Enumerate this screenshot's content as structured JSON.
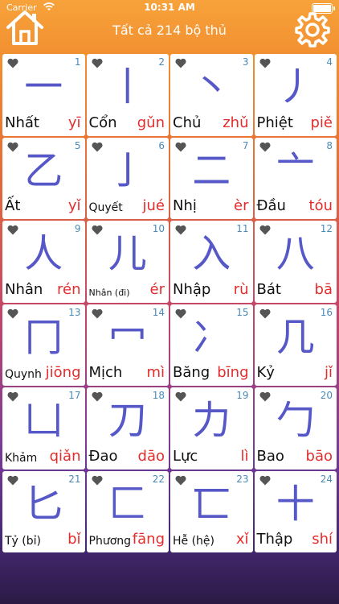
{
  "status_bar": {
    "carrier": "Carrier",
    "time": "10:31 AM",
    "battery_level": 1.0
  },
  "nav": {
    "title": "Tất cả 214 bộ thủ"
  },
  "radicals": [
    {
      "num": "1",
      "char": "一",
      "name": "Nhất",
      "pinyin": "yī",
      "size": "normal"
    },
    {
      "num": "2",
      "char": "丨",
      "name": "Cổn",
      "pinyin": "gǔn",
      "size": "normal"
    },
    {
      "num": "3",
      "char": "丶",
      "name": "Chủ",
      "pinyin": "zhǔ",
      "size": "normal"
    },
    {
      "num": "4",
      "char": "丿",
      "name": "Phiệt",
      "pinyin": "piě",
      "size": "normal"
    },
    {
      "num": "5",
      "char": "乙",
      "name": "Ất",
      "pinyin": "yǐ",
      "size": "normal"
    },
    {
      "num": "6",
      "char": "亅",
      "name": "Quyết",
      "pinyin": "jué",
      "size": "small"
    },
    {
      "num": "7",
      "char": "二",
      "name": "Nhị",
      "pinyin": "èr",
      "size": "normal"
    },
    {
      "num": "8",
      "char": "亠",
      "name": "Đầu",
      "pinyin": "tóu",
      "size": "normal"
    },
    {
      "num": "9",
      "char": "人",
      "name": "Nhân",
      "pinyin": "rén",
      "size": "normal"
    },
    {
      "num": "10",
      "char": "儿",
      "name": "Nhân (đi)",
      "pinyin": "ér",
      "size": "tiny"
    },
    {
      "num": "11",
      "char": "入",
      "name": "Nhập",
      "pinyin": "rù",
      "size": "normal"
    },
    {
      "num": "12",
      "char": "八",
      "name": "Bát",
      "pinyin": "bā",
      "size": "normal"
    },
    {
      "num": "13",
      "char": "冂",
      "name": "Quynh",
      "pinyin": "jiōng",
      "size": "small"
    },
    {
      "num": "14",
      "char": "冖",
      "name": "Mịch",
      "pinyin": "mì",
      "size": "normal"
    },
    {
      "num": "15",
      "char": "冫",
      "name": "Băng",
      "pinyin": "bīng",
      "size": "normal"
    },
    {
      "num": "16",
      "char": "几",
      "name": "Kỷ",
      "pinyin": "jǐ",
      "size": "normal"
    },
    {
      "num": "17",
      "char": "凵",
      "name": "Khảm",
      "pinyin": "qiǎn",
      "size": "small"
    },
    {
      "num": "18",
      "char": "刀",
      "name": "Đao",
      "pinyin": "dāo",
      "size": "normal"
    },
    {
      "num": "19",
      "char": "力",
      "name": "Lực",
      "pinyin": "lì",
      "size": "normal"
    },
    {
      "num": "20",
      "char": "勹",
      "name": "Bao",
      "pinyin": "bāo",
      "size": "normal"
    },
    {
      "num": "21",
      "char": "匕",
      "name": "Tỷ (bỉ)",
      "pinyin": "bǐ",
      "size": "small"
    },
    {
      "num": "22",
      "char": "匚",
      "name": "Phương",
      "pinyin": "fāng",
      "size": "small"
    },
    {
      "num": "23",
      "char": "匸",
      "name": "Hễ (hệ)",
      "pinyin": "xǐ",
      "size": "small"
    },
    {
      "num": "24",
      "char": "十",
      "name": "Thập",
      "pinyin": "shí",
      "size": "normal"
    }
  ],
  "colors": {
    "glyph": "#5658c8",
    "pinyin": "#e32d2d",
    "number": "#4a8ab8",
    "heart": "#555555"
  }
}
